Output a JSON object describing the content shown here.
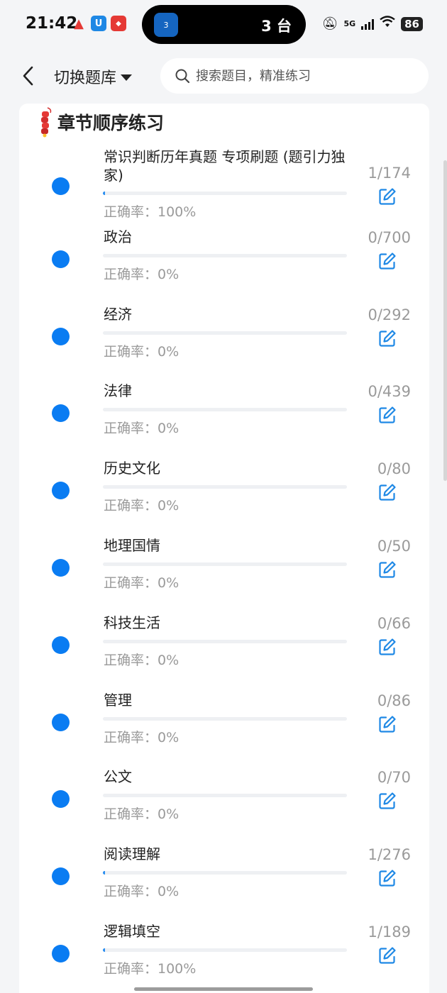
{
  "status_bar": {
    "time": "21:42",
    "island_text": "3 台",
    "island_badge": "3",
    "network": "5G",
    "battery": "86",
    "app_icons": [
      "flame-app-icon",
      "u-app-icon",
      "red-app-icon"
    ]
  },
  "header": {
    "switch_label": "切换题库",
    "search_placeholder": "搜索题目，精准练习"
  },
  "section": {
    "title": "章节顺序练习"
  },
  "colors": {
    "accent": "#0a7cf2",
    "muted": "#9a9a9a",
    "background": "#f4f5f7"
  },
  "chapters": [
    {
      "name": "常识判断历年真题 专项刷题 (题引力独家)",
      "count": "1/174",
      "accuracy": "正确率：100%",
      "progress": 0.006
    },
    {
      "name": "政治",
      "count": "0/700",
      "accuracy": "正确率：0%",
      "progress": 0
    },
    {
      "name": "经济",
      "count": "0/292",
      "accuracy": "正确率：0%",
      "progress": 0
    },
    {
      "name": "法律",
      "count": "0/439",
      "accuracy": "正确率：0%",
      "progress": 0
    },
    {
      "name": "历史文化",
      "count": "0/80",
      "accuracy": "正确率：0%",
      "progress": 0
    },
    {
      "name": "地理国情",
      "count": "0/50",
      "accuracy": "正确率：0%",
      "progress": 0
    },
    {
      "name": "科技生活",
      "count": "0/66",
      "accuracy": "正确率：0%",
      "progress": 0
    },
    {
      "name": "管理",
      "count": "0/86",
      "accuracy": "正确率：0%",
      "progress": 0
    },
    {
      "name": "公文",
      "count": "0/70",
      "accuracy": "正确率：0%",
      "progress": 0
    },
    {
      "name": "阅读理解",
      "count": "1/276",
      "accuracy": "正确率：0%",
      "progress": 0.004
    },
    {
      "name": "逻辑填空",
      "count": "1/189",
      "accuracy": "正确率：100%",
      "progress": 0.005
    }
  ]
}
